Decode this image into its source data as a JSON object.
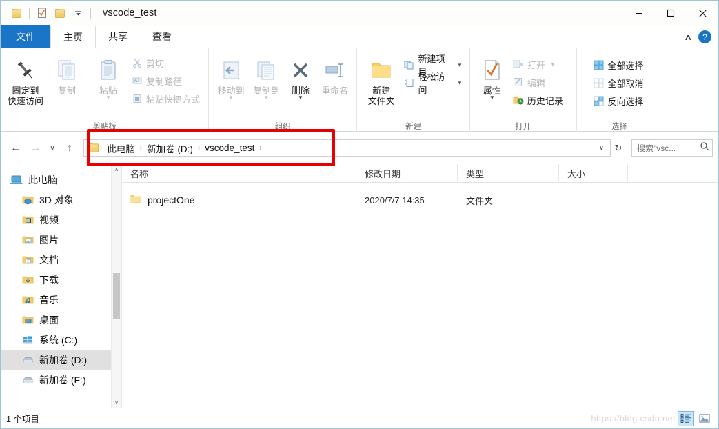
{
  "window": {
    "title": "vscode_test",
    "quick_access": [
      {
        "name": "folder-icon",
        "label": "属性"
      },
      {
        "name": "properties-icon",
        "label": "属性"
      },
      {
        "name": "new-folder-icon",
        "label": "新建文件夹"
      }
    ],
    "controls": {
      "minimize": "—",
      "maximize": "☐",
      "close": "✕"
    }
  },
  "tabs": [
    {
      "label": "文件",
      "state": "file"
    },
    {
      "label": "主页",
      "state": "active"
    },
    {
      "label": "共享",
      "state": "normal"
    },
    {
      "label": "查看",
      "state": "normal"
    }
  ],
  "ribbon": {
    "collapse_label": "∧",
    "help_label": "?",
    "groups": [
      {
        "label": "剪贴板",
        "big": [
          {
            "label": "固定到\n快速访问",
            "icon": "pin-icon",
            "enabled": true,
            "caret": true
          },
          {
            "label": "复制",
            "icon": "copy-icon",
            "enabled": false
          },
          {
            "label": "粘贴",
            "icon": "paste-icon",
            "enabled": false,
            "caret": true
          }
        ],
        "small": [
          {
            "label": "剪切",
            "icon": "scissors-icon",
            "enabled": false
          },
          {
            "label": "复制路径",
            "icon": "copy-path-icon",
            "enabled": false
          },
          {
            "label": "粘贴快捷方式",
            "icon": "paste-shortcut-icon",
            "enabled": false
          }
        ]
      },
      {
        "label": "组织",
        "big": [
          {
            "label": "移动到",
            "icon": "move-to-icon",
            "enabled": false,
            "caret": true
          },
          {
            "label": "复制到",
            "icon": "copy-to-icon",
            "enabled": false,
            "caret": true
          },
          {
            "label": "删除",
            "icon": "delete-icon",
            "enabled": true,
            "caret": true
          },
          {
            "label": "重命名",
            "icon": "rename-icon",
            "enabled": false
          }
        ],
        "small": []
      },
      {
        "label": "新建",
        "big": [
          {
            "label": "新建\n文件夹",
            "icon": "new-folder-icon",
            "enabled": true
          }
        ],
        "small": [
          {
            "label": "新建项目",
            "icon": "new-item-icon",
            "enabled": true,
            "caret": true
          },
          {
            "label": "轻松访问",
            "icon": "easy-access-icon",
            "enabled": true,
            "caret": true
          }
        ]
      },
      {
        "label": "打开",
        "big": [
          {
            "label": "属性",
            "icon": "properties-icon",
            "enabled": true,
            "caret": true
          }
        ],
        "small": [
          {
            "label": "打开",
            "icon": "open-icon",
            "enabled": false,
            "caret": true
          },
          {
            "label": "编辑",
            "icon": "edit-icon",
            "enabled": false
          },
          {
            "label": "历史记录",
            "icon": "history-icon",
            "enabled": true
          }
        ]
      },
      {
        "label": "选择",
        "big": [],
        "small": [
          {
            "label": "全部选择",
            "icon": "select-all-icon",
            "enabled": true
          },
          {
            "label": "全部取消",
            "icon": "select-none-icon",
            "enabled": false
          },
          {
            "label": "反向选择",
            "icon": "invert-selection-icon",
            "enabled": true
          }
        ]
      }
    ]
  },
  "address": {
    "back": "←",
    "forward": "→",
    "recent": "∨",
    "up": "↑",
    "crumbs": [
      "此电脑",
      "新加卷 (D:)",
      "vscode_test"
    ],
    "separator": "›",
    "dropdown": "∨",
    "refresh": "↻"
  },
  "search": {
    "placeholder": "搜索\"vsc...",
    "icon": "search-icon"
  },
  "sidebar": {
    "items": [
      {
        "label": "此电脑",
        "icon": "computer-icon",
        "indent": false,
        "selected": false
      },
      {
        "label": "3D 对象",
        "icon": "3d-objects-icon",
        "indent": true,
        "selected": false
      },
      {
        "label": "视频",
        "icon": "videos-icon",
        "indent": true,
        "selected": false
      },
      {
        "label": "图片",
        "icon": "pictures-icon",
        "indent": true,
        "selected": false
      },
      {
        "label": "文档",
        "icon": "documents-icon",
        "indent": true,
        "selected": false
      },
      {
        "label": "下载",
        "icon": "downloads-icon",
        "indent": true,
        "selected": false
      },
      {
        "label": "音乐",
        "icon": "music-icon",
        "indent": true,
        "selected": false
      },
      {
        "label": "桌面",
        "icon": "desktop-icon",
        "indent": true,
        "selected": false
      },
      {
        "label": "系统 (C:)",
        "icon": "windows-drive-icon",
        "indent": true,
        "selected": false
      },
      {
        "label": "新加卷 (D:)",
        "icon": "drive-icon",
        "indent": true,
        "selected": true
      },
      {
        "label": "新加卷 (F:)",
        "icon": "drive-icon",
        "indent": true,
        "selected": false
      }
    ],
    "scroll_up": "∧",
    "scroll_down": "∨"
  },
  "filelist": {
    "columns": [
      "名称",
      "修改日期",
      "类型",
      "大小"
    ],
    "rows": [
      {
        "name": "projectOne",
        "date": "2020/7/7 14:35",
        "type": "文件夹",
        "size": "",
        "icon": "folder-icon"
      }
    ]
  },
  "status": {
    "item_count": "1 个项目",
    "watermark": "https://blog.csdn.net",
    "views": [
      {
        "name": "details-view-button",
        "selected": true
      },
      {
        "name": "large-icons-view-button",
        "selected": false
      }
    ]
  }
}
